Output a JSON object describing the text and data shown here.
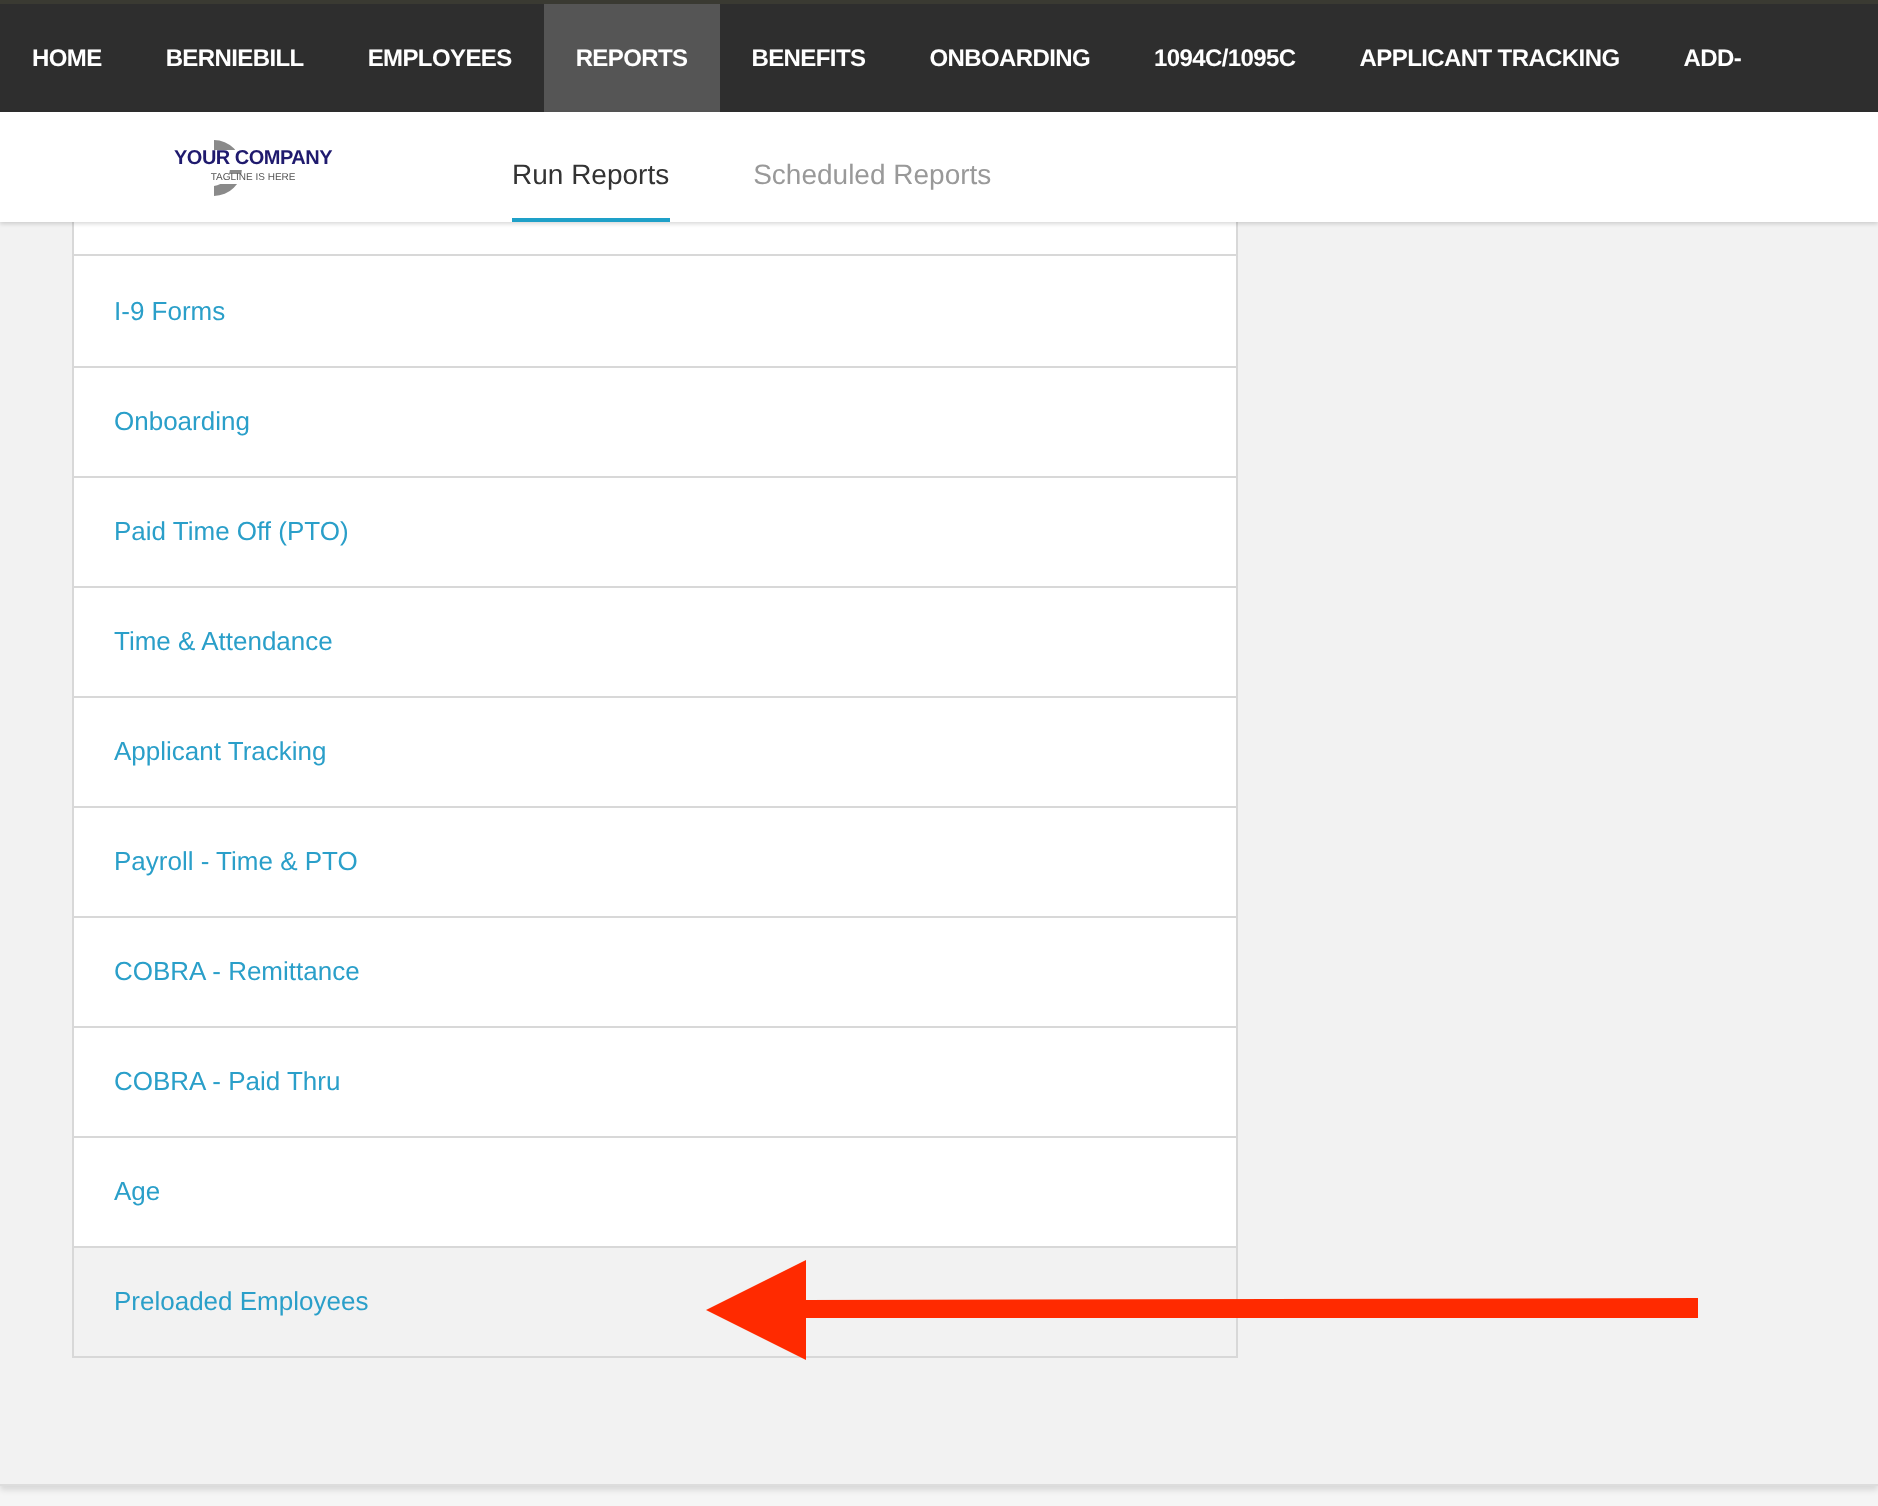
{
  "nav": [
    {
      "label": "HOME",
      "selected": false
    },
    {
      "label": "BERNIEBILL",
      "selected": false
    },
    {
      "label": "EMPLOYEES",
      "selected": false
    },
    {
      "label": "REPORTS",
      "selected": true
    },
    {
      "label": "BENEFITS",
      "selected": false
    },
    {
      "label": "ONBOARDING",
      "selected": false
    },
    {
      "label": "1094C/1095C",
      "selected": false
    },
    {
      "label": "APPLICANT TRACKING",
      "selected": false
    },
    {
      "label": "ADD-",
      "selected": false
    }
  ],
  "logo": {
    "name": "YOUR COMPANY",
    "tagline": "TAGLINE IS HERE"
  },
  "tabs": [
    {
      "label": "Run Reports",
      "selected": true
    },
    {
      "label": "Scheduled Reports",
      "selected": false
    }
  ],
  "reports": [
    {
      "label": "I-9 Forms",
      "highlighted": false
    },
    {
      "label": "Onboarding",
      "highlighted": false
    },
    {
      "label": "Paid Time Off (PTO)",
      "highlighted": false
    },
    {
      "label": "Time & Attendance",
      "highlighted": false
    },
    {
      "label": "Applicant Tracking",
      "highlighted": false
    },
    {
      "label": "Payroll - Time & PTO",
      "highlighted": false
    },
    {
      "label": "COBRA - Remittance",
      "highlighted": false
    },
    {
      "label": "COBRA - Paid Thru",
      "highlighted": false
    },
    {
      "label": "Age",
      "highlighted": false
    },
    {
      "label": "Preloaded Employees",
      "highlighted": true
    }
  ]
}
